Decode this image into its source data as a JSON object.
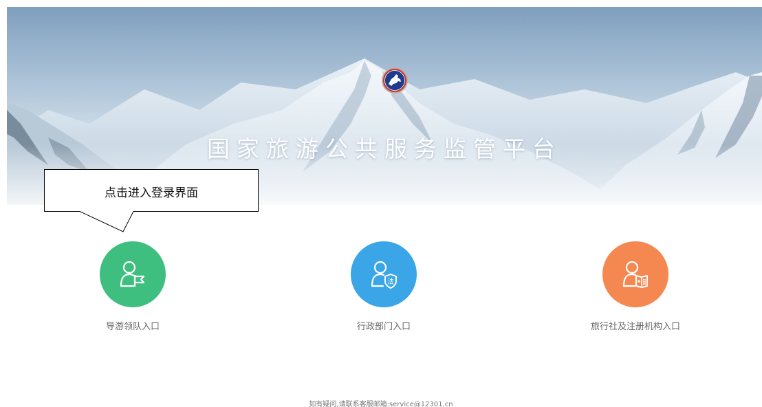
{
  "banner": {
    "title": "国家旅游公共服务监管平台",
    "emblem_icon": "horse-emblem-icon"
  },
  "callout": {
    "text": "点击进入登录界面"
  },
  "entries": [
    {
      "label": "导游领队入口",
      "color": "#3fbf7f",
      "icon": "user-flag-icon"
    },
    {
      "label": "行政部门入口",
      "color": "#3aa6e8",
      "icon": "user-law-shield-icon"
    },
    {
      "label": "旅行社及注册机构入口",
      "color": "#f58850",
      "icon": "user-document-icon"
    }
  ],
  "footer": {
    "text": "如有疑问,请联系客服邮箱:service@12301.cn"
  }
}
